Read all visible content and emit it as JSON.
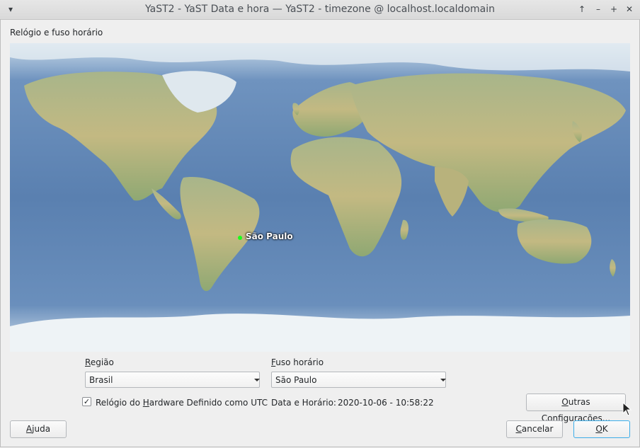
{
  "window": {
    "title": "YaST2 - YaST Data e hora — YaST2 - timezone @ localhost.localdomain",
    "menu_icon": "chevron-down-icon",
    "controls": [
      "keep-above-icon",
      "minimize-icon",
      "maximize-icon",
      "close-icon"
    ]
  },
  "section_label": "Relógio e fuso horário",
  "map": {
    "selected_city": "São Paulo",
    "marker_color": "#19ff19"
  },
  "region": {
    "label": "Região",
    "value": "Brasil"
  },
  "timezone": {
    "label": "Fuso horário",
    "value": "São Paulo"
  },
  "hw_clock": {
    "label": "Relógio do Hardware Definido como UTC",
    "checked": true
  },
  "datetime": {
    "label": "Data e Horário:",
    "value": "2020-10-06 - 10:58:22"
  },
  "buttons": {
    "other_settings": "Outras Configurações...",
    "help": "Ajuda",
    "cancel": "Cancelar",
    "ok": "OK"
  },
  "colors": {
    "accent": "#3daee9",
    "ocean": "#5d84b3",
    "land": "#b9b87e"
  }
}
